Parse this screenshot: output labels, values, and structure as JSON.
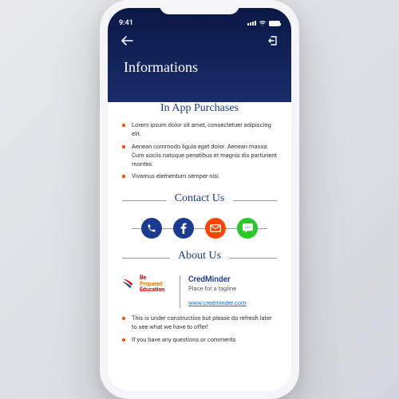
{
  "status": {
    "time": "9:41",
    "wifi": "wifi-icon",
    "battery": 100
  },
  "nav": {
    "back": "back-arrow",
    "logout": "logout-icon"
  },
  "page_title": "Informations",
  "sections": {
    "purchases": {
      "heading": "In App Purchases",
      "items": [
        "Lorem ipsum dolor sit amet, consectetuer adipiscing elit.",
        "Aenean commodo ligula eget dolor. Aenean massa. Cum sociis natoque penatibus et magnis dis parturient montes.",
        "Vivamus elementum semper nisi."
      ]
    },
    "contact": {
      "heading": "Contact Us",
      "buttons": [
        {
          "name": "phone-button",
          "icon": "phone-icon"
        },
        {
          "name": "facebook-button",
          "icon": "facebook-icon"
        },
        {
          "name": "email-button",
          "icon": "mail-icon"
        },
        {
          "name": "sms-button",
          "icon": "sms-icon"
        }
      ]
    },
    "about": {
      "heading": "About Us",
      "logo": {
        "line1": "Be",
        "line2": "Prepared",
        "line3": "Education"
      },
      "brand_name": "CredMinder",
      "brand_tagline": "Place for a tagline",
      "brand_url": "www.credminder.com",
      "items": [
        "This is under construction but please do refresh later to see what we have to offer!",
        "If you have any questions or comments"
      ]
    }
  },
  "colors": {
    "primary": "#1a3b8f",
    "accent": "#ff4500",
    "success": "#29c729"
  }
}
